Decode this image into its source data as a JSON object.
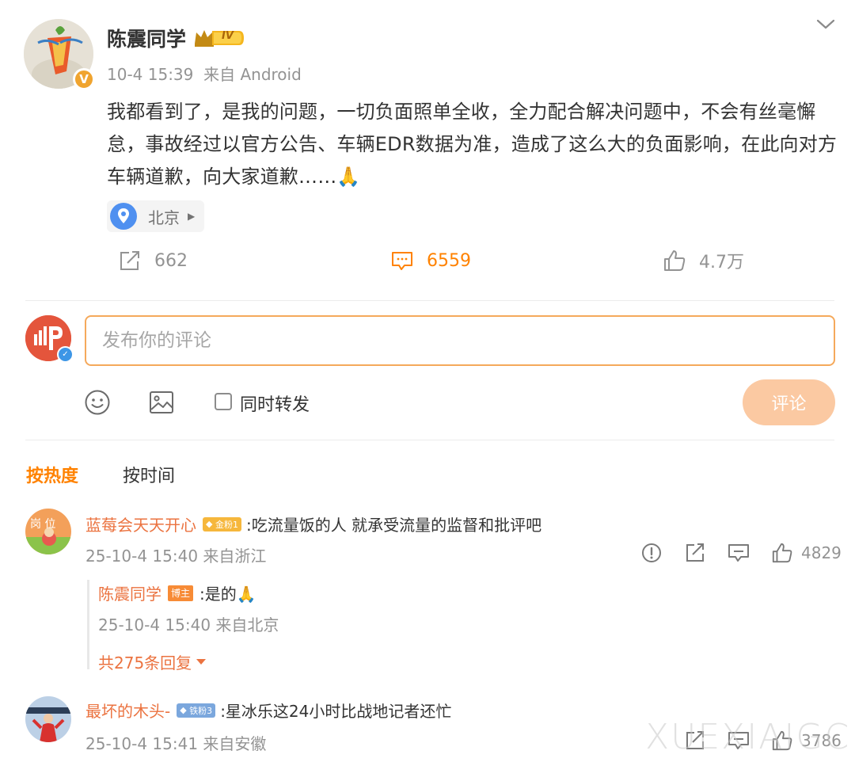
{
  "post": {
    "author": "陈震同学",
    "verified_badge": "V",
    "level_badge": "IV",
    "timestamp": "10-4 15:39",
    "source": "来自 Android",
    "text": "我都看到了，是我的问题，一切负面照单全收，全力配合解决问题中，不会有丝毫懈怠，事故经过以官方公告、车辆EDR数据为准，造成了这么大的负面影响，在此向对方车辆道歉，向大家道歉……🙏",
    "location": "北京",
    "reposts": "662",
    "comments": "6559",
    "likes": "4.7万"
  },
  "compose": {
    "placeholder": "发布你的评论",
    "forward_label": "同时转发",
    "submit_label": "评论"
  },
  "sort_tabs": {
    "hot": "按热度",
    "time": "按时间"
  },
  "comments": [
    {
      "name": "蓝莓会天天开心",
      "fan_badge": "金粉1",
      "text": ":吃流量饭的人 就承受流量的监督和批评吧",
      "timestamp": "25-10-4 15:40 来自浙江",
      "likes": "4829",
      "reply": {
        "name": "陈震同学",
        "badge": "博主",
        "text": ":是的🙏",
        "timestamp": "25-10-4 15:40 来自北京"
      },
      "more_replies": "共275条回复"
    },
    {
      "name": "最坏的木头-",
      "fan_badge": "铁粉3",
      "text": ":星冰乐这24小时比战地记者还忙",
      "timestamp": "25-10-4 15:41 来自安徽",
      "likes": "3786"
    }
  ],
  "watermark": "XUEXIAIGC",
  "colors": {
    "accent": "#ff8200",
    "name": "#eb7340",
    "meta": "#939393",
    "input_border": "#f5a95b",
    "submit_bg": "#fbc9a2"
  }
}
